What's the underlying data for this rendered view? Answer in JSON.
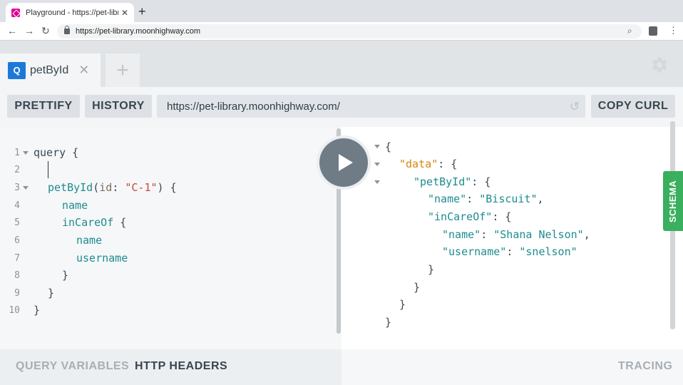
{
  "browser": {
    "tab_title": "Playground - https://pet-library.",
    "tab_close": "✕",
    "new_tab": "+",
    "back": "←",
    "forward": "→",
    "reload": "↻",
    "url": "https://pet-library.moonhighway.com",
    "zoom_icon": "⌕",
    "menu": "⋮"
  },
  "playground": {
    "tab": {
      "badge": "Q",
      "name": "petById",
      "close": "✕"
    },
    "new_tab": "+",
    "toolbar": {
      "prettify": "PRETTIFY",
      "history": "HISTORY",
      "endpoint": "https://pet-library.moonhighway.com/",
      "copy_curl": "COPY CURL"
    },
    "editor": {
      "line_numbers": [
        "1",
        "2",
        "3",
        "4",
        "5",
        "6",
        "7",
        "8",
        "9",
        "10"
      ],
      "lines": {
        "l1": "query {",
        "l3_fn": "petById",
        "l3_open": "(",
        "l3_arg": "id",
        "l3_colon": ": ",
        "l3_str": "\"C-1\"",
        "l3_close": ") {",
        "l4": "name",
        "l5_fld": "inCareOf",
        "l5_brace": " {",
        "l6": "name",
        "l7": "username",
        "l8": "}",
        "l9": "}",
        "l10": "}"
      }
    },
    "result": {
      "r1": "{",
      "r2_key": "\"data\"",
      "r2_rest": ": {",
      "r3_key": "\"petById\"",
      "r3_rest": ": {",
      "r4_key": "\"name\"",
      "r4_sep": ": ",
      "r4_val": "\"Biscuit\"",
      "r4_comma": ",",
      "r5_key": "\"inCareOf\"",
      "r5_rest": ": {",
      "r6_key": "\"name\"",
      "r6_sep": ": ",
      "r6_val": "\"Shana Nelson\"",
      "r6_comma": ",",
      "r7_key": "\"username\"",
      "r7_sep": ": ",
      "r7_val": "\"snelson\"",
      "r8": "}",
      "r9": "}",
      "r10": "}",
      "r11": "}"
    },
    "schema": "SCHEMA",
    "bottom": {
      "query_variables": "QUERY VARIABLES",
      "http_headers": "HTTP HEADERS",
      "tracing": "TRACING"
    }
  }
}
